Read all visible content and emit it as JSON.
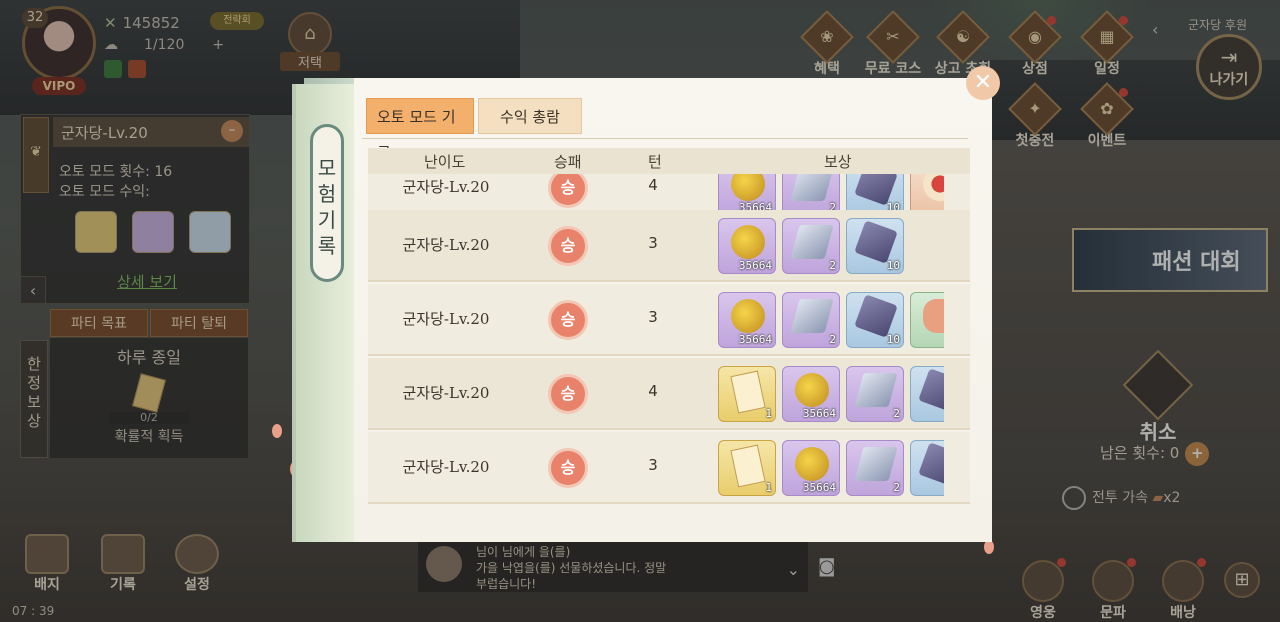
{
  "status": {
    "level": "32",
    "vip": "VIPO",
    "power": "145852",
    "power_badge": "전략회",
    "stamina": "1/120",
    "stamina_plus": "+"
  },
  "home": {
    "label": "저택"
  },
  "top_menu": [
    {
      "label": "혜택",
      "icon": "gift-icon"
    },
    {
      "label": "무료 코스튬",
      "icon": "costume-icon"
    },
    {
      "label": "상고 초회",
      "icon": "summon-icon"
    },
    {
      "label": "상점",
      "icon": "shop-icon"
    },
    {
      "label": "일정",
      "icon": "calendar-icon"
    },
    {
      "label": "첫충전",
      "icon": "first-charge-icon"
    },
    {
      "label": "이벤트",
      "icon": "event-icon"
    }
  ],
  "guild_tag": "군자당 후원",
  "exit_label": "나가기",
  "left_panel": {
    "stage_title": "군자당-Lv.20",
    "auto_count_label": "오토 모드 횟수:",
    "auto_count_value": "16",
    "auto_income_label": "오토 모드 수익:",
    "detail_link": "상세 보기",
    "party_goal": "파티 목표",
    "party_leave": "파티 탈퇴",
    "limited_reward": "한정보상",
    "daily_title": "하루 종일",
    "daily_progress": "0/2",
    "daily_sub": "확률적 획득"
  },
  "bottom_left": [
    {
      "label": "배지",
      "icon": "badge-icon"
    },
    {
      "label": "기록",
      "icon": "record-icon"
    },
    {
      "label": "설정",
      "icon": "settings-icon"
    }
  ],
  "time": "07 : 39",
  "chat": {
    "line1": "님이 님에게 을(를)",
    "line2": "가을 낙엽을(를) 선물하셨습니다. 정말",
    "line3": "부럽습니다!"
  },
  "bottom_right": [
    {
      "label": "영웅",
      "icon": "hero-icon"
    },
    {
      "label": "문파",
      "icon": "sect-icon"
    },
    {
      "label": "배낭",
      "icon": "bag-icon"
    }
  ],
  "fashion_banner": "패션 대회",
  "cancel_label": "취소",
  "remaining_label": "남은 횟수: 0",
  "battle_speed_label": "전투 가속",
  "battle_speed_value": "x2",
  "modal": {
    "title": "모험기록",
    "tabs": [
      {
        "label": "오토 모드 기록",
        "active": true
      },
      {
        "label": "수익 총람",
        "active": false
      }
    ],
    "columns": {
      "difficulty": "난이도",
      "result": "승패",
      "turns": "턴",
      "rewards": "보상"
    },
    "rows": [
      {
        "difficulty": "군자당-Lv.20",
        "result": "승",
        "turns": "4",
        "rewards": [
          {
            "type": "money",
            "rarity": "purple",
            "count": "35664"
          },
          {
            "type": "bar",
            "rarity": "purple",
            "count": "2"
          },
          {
            "type": "ore",
            "rarity": "blue",
            "count": "10"
          },
          {
            "type": "cake",
            "rarity": "orange",
            "count": ""
          }
        ]
      },
      {
        "difficulty": "군자당-Lv.20",
        "result": "승",
        "turns": "3",
        "rewards": [
          {
            "type": "money",
            "rarity": "purple",
            "count": "35664"
          },
          {
            "type": "bar",
            "rarity": "purple",
            "count": "2"
          },
          {
            "type": "ore",
            "rarity": "blue",
            "count": "10"
          }
        ]
      },
      {
        "difficulty": "군자당-Lv.20",
        "result": "승",
        "turns": "3",
        "rewards": [
          {
            "type": "money",
            "rarity": "purple",
            "count": "35664"
          },
          {
            "type": "bar",
            "rarity": "purple",
            "count": "2"
          },
          {
            "type": "ore",
            "rarity": "blue",
            "count": "10"
          },
          {
            "type": "meat",
            "rarity": "green",
            "count": ""
          }
        ]
      },
      {
        "difficulty": "군자당-Lv.20",
        "result": "승",
        "turns": "4",
        "rewards": [
          {
            "type": "scroll",
            "rarity": "gold",
            "count": "1"
          },
          {
            "type": "money",
            "rarity": "purple",
            "count": "35664"
          },
          {
            "type": "bar",
            "rarity": "purple",
            "count": "2"
          },
          {
            "type": "ore",
            "rarity": "blue",
            "count": ""
          }
        ]
      },
      {
        "difficulty": "군자당-Lv.20",
        "result": "승",
        "turns": "3",
        "rewards": [
          {
            "type": "scroll",
            "rarity": "gold",
            "count": "1"
          },
          {
            "type": "money",
            "rarity": "purple",
            "count": "35664"
          },
          {
            "type": "bar",
            "rarity": "purple",
            "count": "2"
          },
          {
            "type": "ore",
            "rarity": "blue",
            "count": ""
          }
        ]
      }
    ]
  }
}
